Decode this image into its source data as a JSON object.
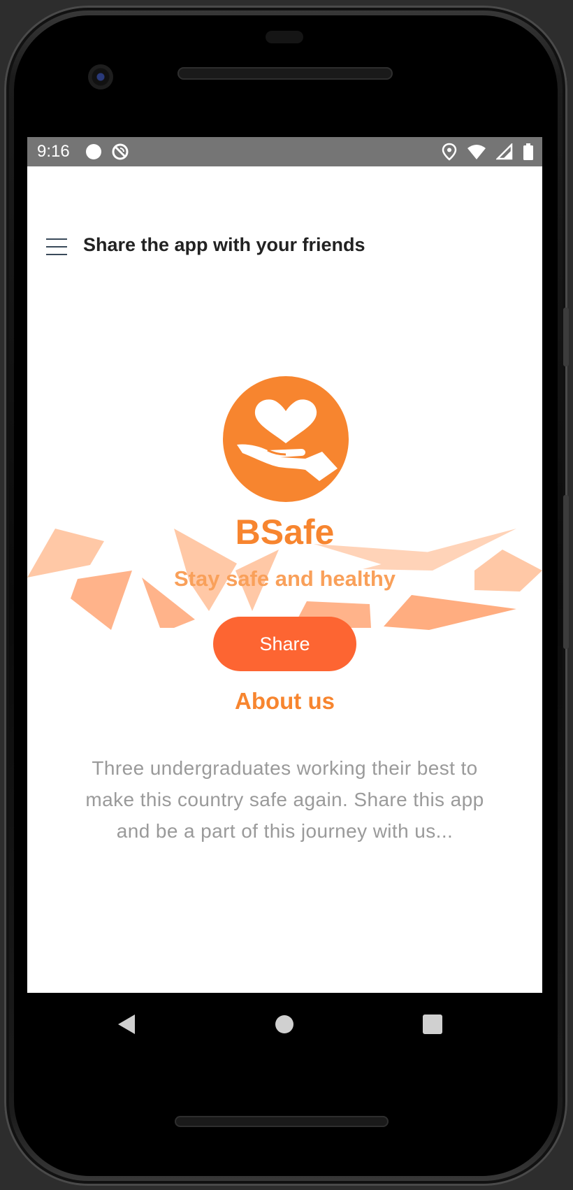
{
  "status_bar": {
    "time": "9:16",
    "icons_left": [
      "circle-notification-icon",
      "do-not-disturb-icon"
    ],
    "icons_right": [
      "location-icon",
      "wifi-icon",
      "cell-signal-icon",
      "battery-icon"
    ]
  },
  "toolbar": {
    "title": "Share the app with your friends",
    "menu_icon": "hamburger-menu-icon"
  },
  "hero": {
    "logo_icon": "heart-in-hand-icon",
    "app_name": "BSafe",
    "tagline": "Stay safe and healthy",
    "share_label": "Share"
  },
  "about": {
    "title": "About us",
    "text": "Three undergraduates working their best to make this country safe again. Share this app and be a part of this journey with us..."
  },
  "navigation": {
    "back_icon": "triangle-back-icon",
    "home_icon": "circle-home-icon",
    "recents_icon": "square-recents-icon"
  },
  "colors": {
    "accent": "#f7852f",
    "tagline": "#f9a05a",
    "button": "#fd6532",
    "status_bar": "#757575",
    "body_text": "#9a9a9a"
  }
}
